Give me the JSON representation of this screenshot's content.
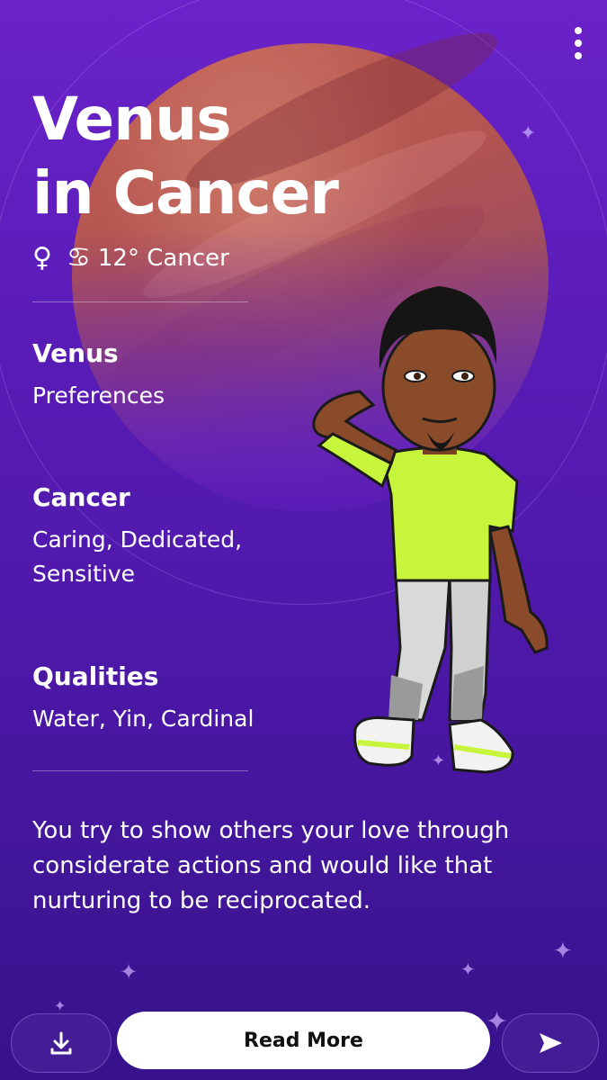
{
  "header": {
    "title_line1": "Venus",
    "title_line2": "in Cancer",
    "planet_symbol": "♀",
    "sign_symbol": "♋",
    "placement_text": "12° Cancer",
    "menu_icon": "more-vertical-icon"
  },
  "sections": [
    {
      "label": "Venus",
      "value": "Preferences"
    },
    {
      "label": "Cancer",
      "value": "Caring, Dedicated, Sensitive"
    },
    {
      "label": "Qualities",
      "value": "Water, Yin, Cardinal"
    }
  ],
  "description": "You try to show others your love through considerate actions and would like that nurturing to be reciprocated.",
  "footer": {
    "download_icon": "download-icon",
    "read_more_label": "Read More",
    "send_icon": "send-icon"
  },
  "colors": {
    "background": "#5a1cb8",
    "planet": "#b9584a",
    "shirt": "#c6f53c",
    "button_bg": "#ffffff"
  }
}
